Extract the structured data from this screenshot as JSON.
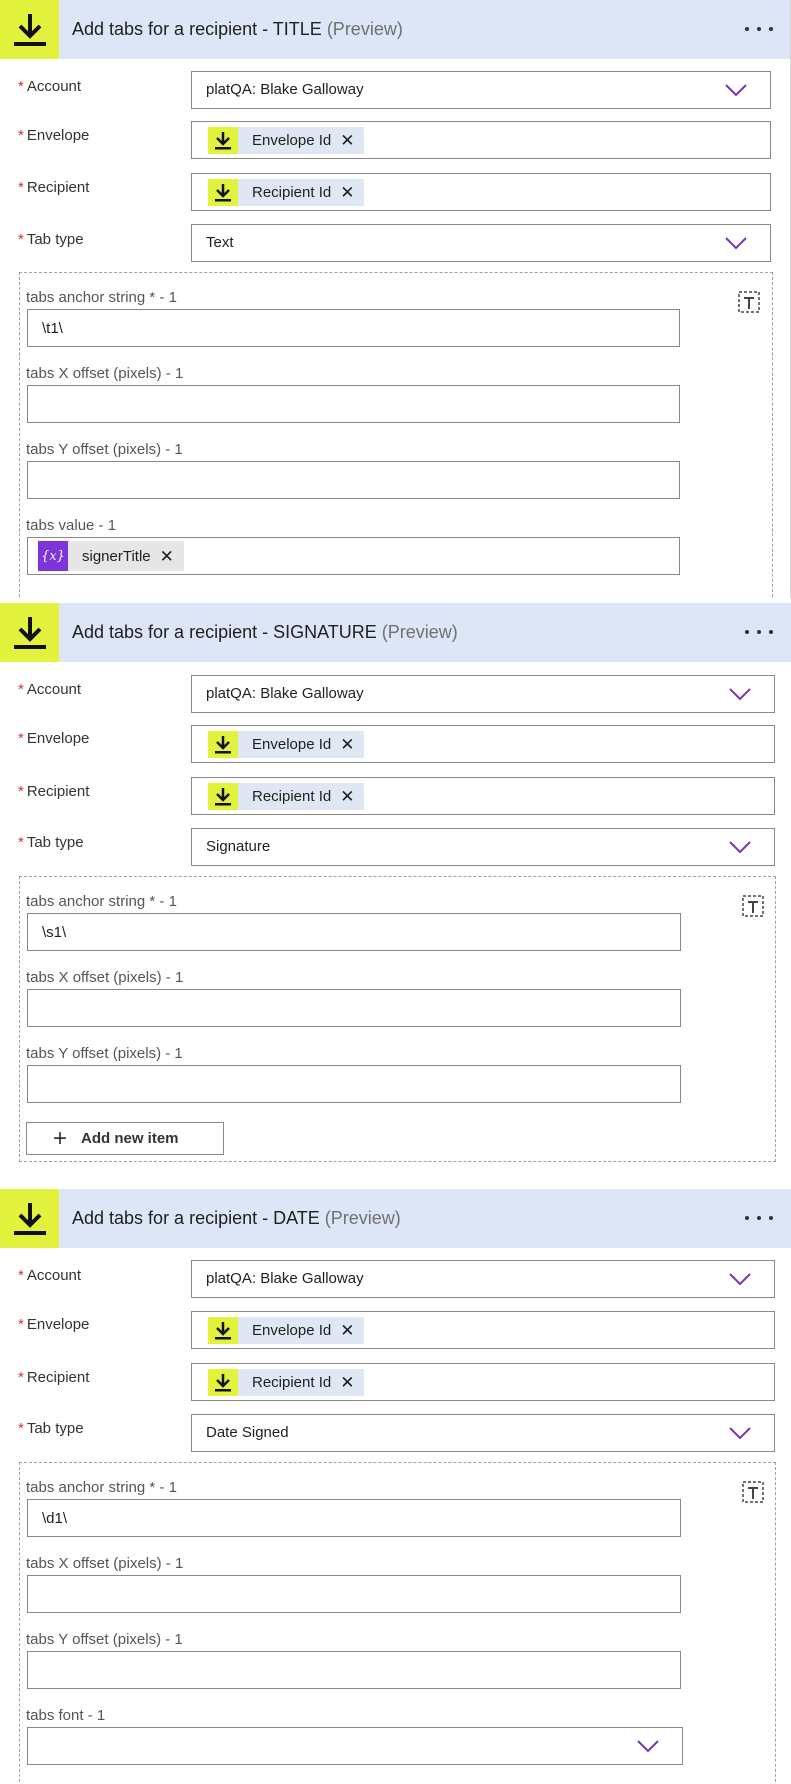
{
  "colors": {
    "header_bg": "#dce6f7",
    "connector_yellow": "#e3f23d",
    "required_red": "#d13438",
    "chevron_purple": "#7d35a8",
    "variable_purple": "#7d35d9"
  },
  "cards": [
    {
      "title": "Add tabs for a recipient - TITLE",
      "preview": "(Preview)",
      "account_label": "Account",
      "account_value": "platQA: Blake Galloway",
      "envelope_label": "Envelope",
      "envelope_token": "Envelope Id",
      "recipient_label": "Recipient",
      "recipient_token": "Recipient Id",
      "tabtype_label": "Tab type",
      "tabtype_value": "Text",
      "anchor_label": "tabs anchor string * - 1",
      "anchor_value": "\\t1\\",
      "xoffset_label": "tabs X offset (pixels) - 1",
      "yoffset_label": "tabs Y offset (pixels) - 1",
      "value_label": "tabs value - 1",
      "value_token": "signerTitle",
      "variable_icon_glyph": "{x}"
    },
    {
      "title": "Add tabs for a recipient - SIGNATURE",
      "preview": "(Preview)",
      "account_label": "Account",
      "account_value": "platQA: Blake Galloway",
      "envelope_label": "Envelope",
      "envelope_token": "Envelope Id",
      "recipient_label": "Recipient",
      "recipient_token": "Recipient Id",
      "tabtype_label": "Tab type",
      "tabtype_value": "Signature",
      "anchor_label": "tabs anchor string * - 1",
      "anchor_value": "\\s1\\",
      "xoffset_label": "tabs X offset (pixels) - 1",
      "yoffset_label": "tabs Y offset (pixels) - 1",
      "add_item_label": "Add new item"
    },
    {
      "title": "Add tabs for a recipient - DATE",
      "preview": "(Preview)",
      "account_label": "Account",
      "account_value": "platQA: Blake Galloway",
      "envelope_label": "Envelope",
      "envelope_token": "Envelope Id",
      "recipient_label": "Recipient",
      "recipient_token": "Recipient Id",
      "tabtype_label": "Tab type",
      "tabtype_value": "Date Signed",
      "anchor_label": "tabs anchor string * - 1",
      "anchor_value": "\\d1\\",
      "xoffset_label": "tabs X offset (pixels) - 1",
      "yoffset_label": "tabs Y offset (pixels) - 1",
      "font_label": "tabs font - 1"
    }
  ],
  "icons": {
    "connector": "download-arrow-icon",
    "more": "more-options-icon",
    "chevron": "chevron-down-icon",
    "remove": "close-icon",
    "delete_item": "delete-item-icon",
    "variable": "variable-icon",
    "add": "plus-icon"
  }
}
